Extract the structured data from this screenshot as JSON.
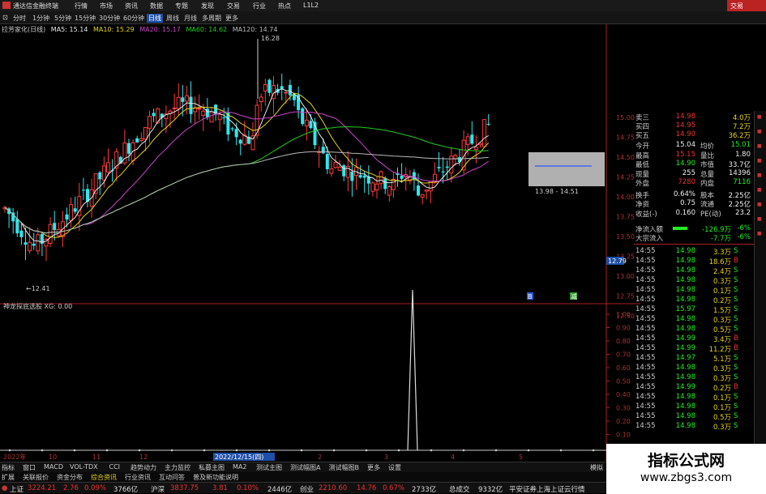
{
  "window": {
    "title": "通达信金融终端",
    "trade_button": "交易"
  },
  "menu": [
    "行情",
    "市场",
    "资讯",
    "数据",
    "专题",
    "发现",
    "交易",
    "行业",
    "热点",
    "L1L2"
  ],
  "toolbar": {
    "items": [
      "分时",
      "1分钟",
      "5分钟",
      "15分钟",
      "30分钟",
      "60分钟",
      "日线",
      "周线",
      "月线",
      "多周期",
      "更多"
    ],
    "active": "日线"
  },
  "main_chart": {
    "name": "拉芳家化(日线)",
    "ma_labels": [
      "MA5: 15.14",
      "MA10: 15.29",
      "MA20: 15.17",
      "MA60: 14.62",
      "MA120: 14.74"
    ],
    "ma_colors": [
      "#e8e8e8",
      "#e6d21f",
      "#cc44cc",
      "#22cc22",
      "#bbbbbb"
    ],
    "high_label": "16.28",
    "low_label": "12.41",
    "box_label": "13.98 - 14.51",
    "y_ticks": [
      "15.00",
      "14.75",
      "14.50",
      "14.25",
      "14.00",
      "13.75",
      "13.50",
      "13.25",
      "13.00",
      "12.75",
      "12.50"
    ],
    "current_price_tag": "12.79",
    "marker_left": "B",
    "marker_right": "减"
  },
  "indicator": {
    "title": "神龙探底选股  XG: 0.00",
    "y_ticks": [
      "1.00",
      "0.90",
      "0.80",
      "0.70",
      "0.60",
      "0.50",
      "0.40",
      "0.30",
      "0.20",
      "0.10",
      "0.00"
    ],
    "x_labels": [
      "2022年",
      "10",
      "11",
      "12",
      "2022/12/15(四)",
      "2",
      "3",
      "4",
      "5"
    ]
  },
  "quote_panel": {
    "order_book": [
      {
        "label": "卖三",
        "price": "14.98",
        "vol": "4.0万"
      },
      {
        "label": "买四",
        "price": "14.95",
        "vol": "7.2万"
      },
      {
        "label": "买五",
        "price": "14.90",
        "vol": "36.2万"
      }
    ],
    "stats": [
      {
        "l1": "今开",
        "v1": "15.04",
        "l2": "均价",
        "v2": "15.01"
      },
      {
        "l1": "最高",
        "v1": "15.15",
        "l2": "量比",
        "v2": "1.80"
      },
      {
        "l1": "最低",
        "v1": "14.90",
        "l2": "市值",
        "v2": "33.7亿"
      },
      {
        "l1": "现量",
        "v1": "255",
        "l2": "总量",
        "v2": "14396"
      },
      {
        "l1": "外盘",
        "v1": "7280",
        "l2": "内盘",
        "v2": "7116"
      },
      {
        "l1": "换手",
        "v1": "0.64%",
        "l2": "股本",
        "v2": "2.25亿"
      },
      {
        "l1": "净资",
        "v1": "0.75",
        "l2": "流通",
        "v2": "2.25亿"
      },
      {
        "l1": "收益(-)",
        "v1": "0.160",
        "l2": "PE(动)",
        "v2": "23.2"
      }
    ],
    "flows": [
      {
        "label": "净流入额",
        "value": "-126.9万",
        "pct": "-6%"
      },
      {
        "label": "大宗流入",
        "value": "-7.7万",
        "pct": "-6%"
      }
    ],
    "ticks": [
      {
        "time": "14:55",
        "price": "14.98",
        "vol": "3.3万",
        "side": "S"
      },
      {
        "time": "14:55",
        "price": "14.98",
        "vol": "18.6万",
        "side": "B"
      },
      {
        "time": "14:55",
        "price": "14.98",
        "vol": "2.4万",
        "side": "S"
      },
      {
        "time": "14:55",
        "price": "14.98",
        "vol": "0.3万",
        "side": "S"
      },
      {
        "time": "14:55",
        "price": "14.98",
        "vol": "0.1万",
        "side": "S"
      },
      {
        "time": "14:55",
        "price": "14.98",
        "vol": "0.2万",
        "side": "S"
      },
      {
        "time": "14:55",
        "price": "15.97",
        "vol": "1.5万",
        "side": "S"
      },
      {
        "time": "14:55",
        "price": "14.98",
        "vol": "0.3万",
        "side": "S"
      },
      {
        "time": "14:55",
        "price": "14.98",
        "vol": "0.5万",
        "side": "S"
      },
      {
        "time": "14:55",
        "price": "14.99",
        "vol": "3.4万",
        "side": "B"
      },
      {
        "time": "14:55",
        "price": "14.99",
        "vol": "11.2万",
        "side": "B"
      },
      {
        "time": "14:55",
        "price": "14.97",
        "vol": "5.1万",
        "side": "S"
      },
      {
        "time": "14:55",
        "price": "14.98",
        "vol": "0.3万",
        "side": "S"
      },
      {
        "time": "14:55",
        "price": "14.98",
        "vol": "0.3万",
        "side": "S"
      },
      {
        "time": "14:55",
        "price": "14.99",
        "vol": "0.2万",
        "side": "B"
      },
      {
        "time": "14:55",
        "price": "14.98",
        "vol": "0.1万",
        "side": "S"
      },
      {
        "time": "14:55",
        "price": "14.98",
        "vol": "0.1万",
        "side": "S"
      },
      {
        "time": "14:55",
        "price": "14.98",
        "vol": "0.5万",
        "side": "S"
      },
      {
        "time": "14:55",
        "price": "14.98",
        "vol": "0.3万",
        "side": "S"
      }
    ]
  },
  "bottom_tabs": [
    "指标",
    "窗口",
    "MACD",
    "VOL-TDX",
    "CCI",
    "趋势动力",
    "主力监控",
    "私募主图",
    "MA2",
    "测试主图",
    "测试幅图A",
    "测试幅图B",
    "更多",
    "设置"
  ],
  "bottom_tabs2": [
    "扩展",
    "关联报价",
    "资金分布",
    "综合资讯",
    "行业资讯",
    "互动问答",
    "普及新功能说明"
  ],
  "status_bar": [
    {
      "name": "上证",
      "value": "3224.21",
      "chg": "2.76",
      "pct": "0.09%",
      "amt": "3766亿"
    },
    {
      "name": "沪深",
      "value": "3837.75",
      "chg": "3.81",
      "pct": "0.10%",
      "amt": "2446亿"
    },
    {
      "name": "创业",
      "value": "2210.60",
      "chg": "14.76",
      "pct": "0.67%",
      "amt": "2733亿"
    }
  ],
  "status_total": {
    "label": "总成交",
    "value": "9332亿"
  },
  "status_broker": "平安证券上海上证云行情",
  "watermark": {
    "line1": "指标公式网",
    "line2": "www.zbgs3.com"
  },
  "side_mode_label": "图文F10",
  "side_mode_label2": "模拟"
}
